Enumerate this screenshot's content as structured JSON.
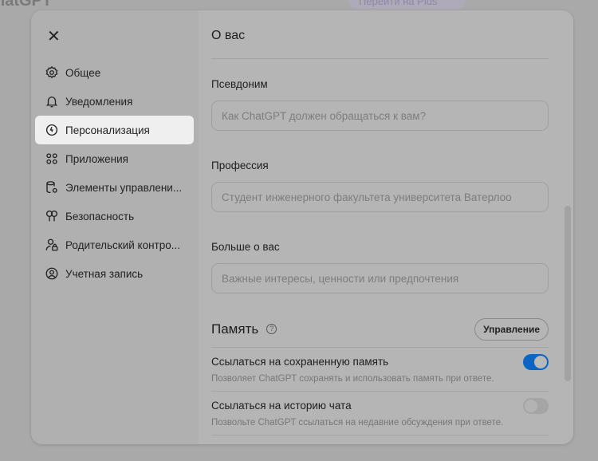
{
  "background": {
    "app_title": "hatGPT",
    "upgrade_button": "Перейти на Plus"
  },
  "sidebar": {
    "close": "✕",
    "items": [
      {
        "label": "Общее",
        "icon": "gear-icon"
      },
      {
        "label": "Уведомления",
        "icon": "bell-icon"
      },
      {
        "label": "Персонализация",
        "icon": "personalization-icon",
        "active": true
      },
      {
        "label": "Приложения",
        "icon": "apps-grid-icon"
      },
      {
        "label": "Элементы управлени...",
        "icon": "database-gear-icon"
      },
      {
        "label": "Безопасность",
        "icon": "keys-icon"
      },
      {
        "label": "Родительский контро...",
        "icon": "user-lock-icon"
      },
      {
        "label": "Учетная запись",
        "icon": "account-circle-icon"
      }
    ]
  },
  "main": {
    "section_title": "О вас",
    "fields": [
      {
        "label": "Псевдоним",
        "placeholder": "Как ChatGPT должен обращаться к вам?"
      },
      {
        "label": "Профессия",
        "placeholder": "Студент инженерного факультета университета Ватерлоо"
      },
      {
        "label": "Больше о вас",
        "placeholder": "Важные интересы, ценности или предпочтения"
      }
    ],
    "memory": {
      "title": "Память",
      "help": "?",
      "manage_button": "Управление",
      "settings": [
        {
          "title": "Ссылаться на сохраненную память",
          "desc": "Позволяет ChatGPT сохранять и использовать память при ответе.",
          "enabled": true
        },
        {
          "title": "Ссылаться на историю чата",
          "desc": "Позвольте ChatGPT ссылаться на недавние обсуждения при ответе.",
          "enabled": false
        }
      ]
    }
  },
  "colors": {
    "toggle_on": "#0a66c2",
    "active_nav": "#efefef"
  }
}
